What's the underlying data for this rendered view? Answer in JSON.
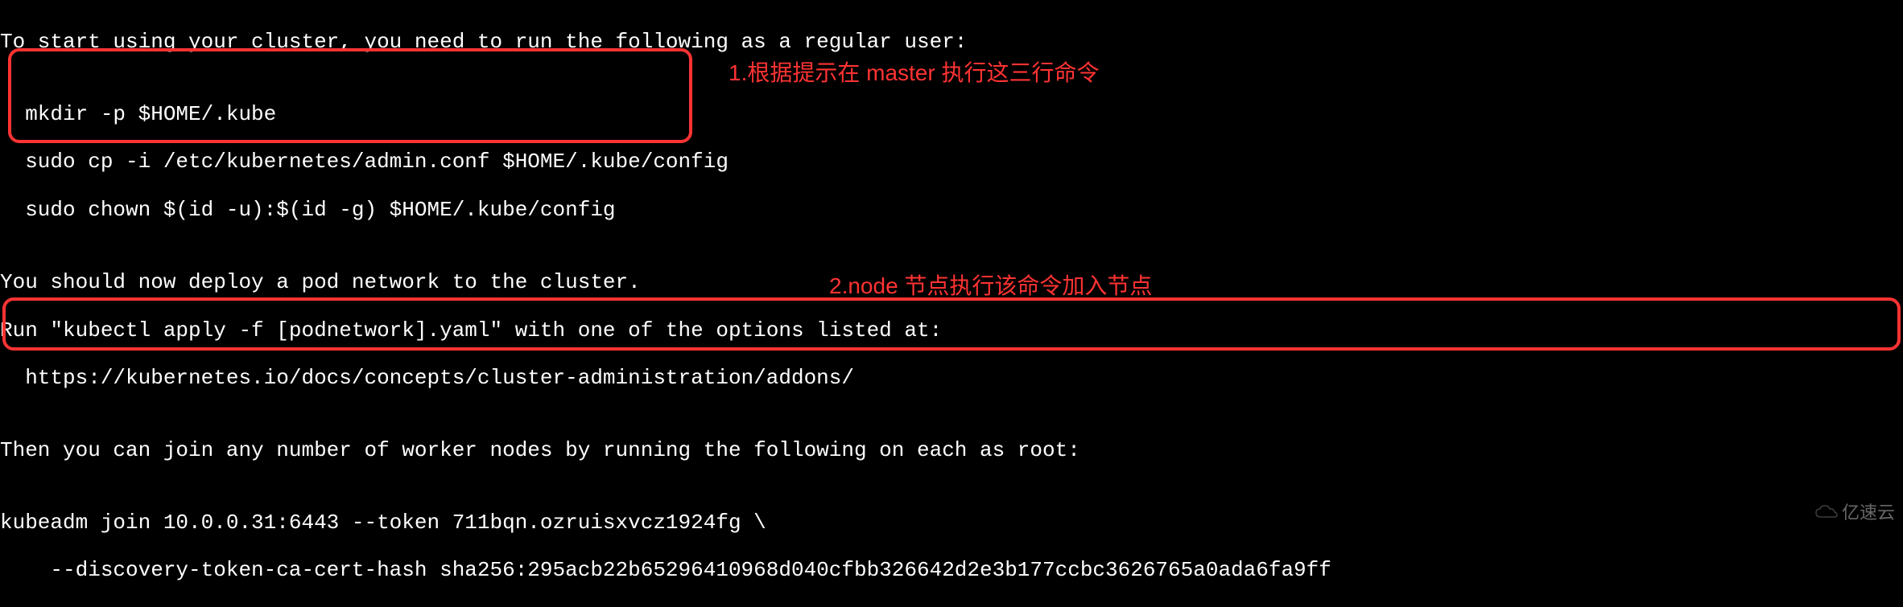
{
  "terminal": {
    "l1": "To start using your cluster, you need to run the following as a regular user:",
    "l2": "",
    "l3": "  mkdir -p $HOME/.kube",
    "l4": "  sudo cp -i /etc/kubernetes/admin.conf $HOME/.kube/config",
    "l5": "  sudo chown $(id -u):$(id -g) $HOME/.kube/config",
    "l6": "",
    "l7": "You should now deploy a pod network to the cluster.",
    "l8": "Run \"kubectl apply -f [podnetwork].yaml\" with one of the options listed at:",
    "l9": "  https://kubernetes.io/docs/concepts/cluster-administration/addons/",
    "l10": "",
    "l11": "Then you can join any number of worker nodes by running the following on each as root:",
    "l12": "",
    "l13": "kubeadm join 10.0.0.31:6443 --token 711bqn.ozruisxvcz1924fg \\",
    "l14": "    --discovery-token-ca-cert-hash sha256:295acb22b65296410968d040cfbb326642d2e3b177ccbc3626765a0ada6fa9ff"
  },
  "annotations": {
    "a1": "1.根据提示在 master 执行这三行命令",
    "a2": "2.node 节点执行该命令加入节点"
  },
  "watermark": {
    "text": "亿速云"
  }
}
